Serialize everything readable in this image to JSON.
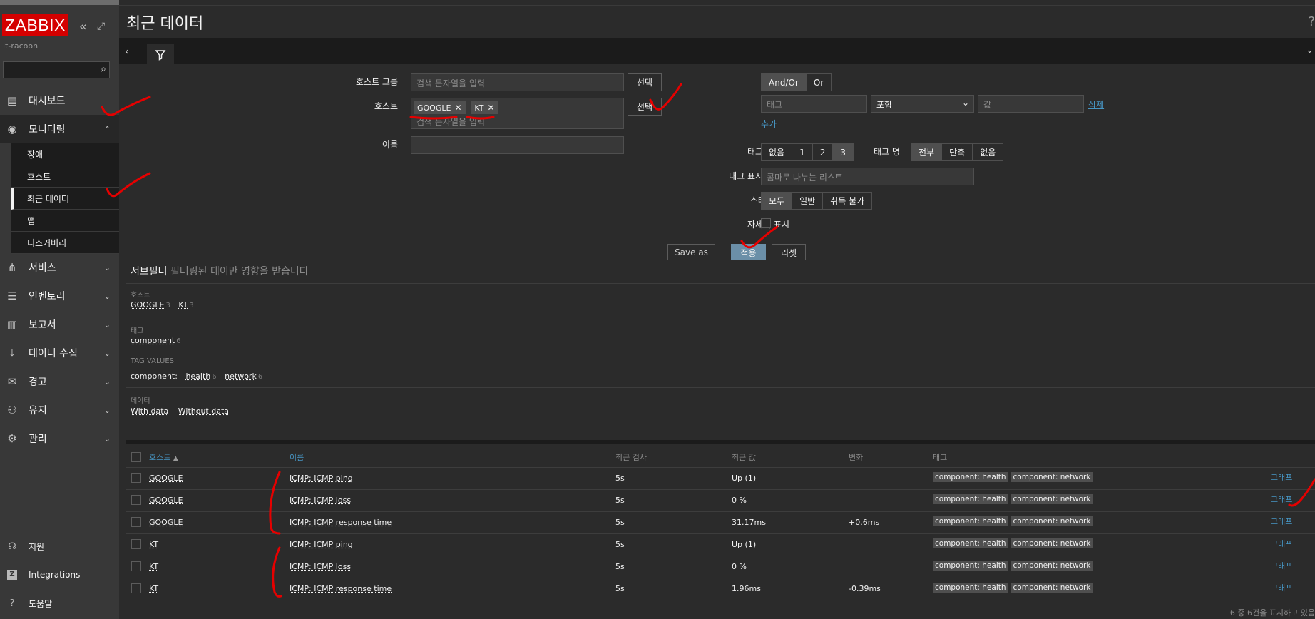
{
  "sidebar": {
    "logo": "ZABBIX",
    "server_name": "it-racoon",
    "menu": [
      {
        "label": "대시보드"
      },
      {
        "label": "모니터링"
      },
      {
        "label": "서비스"
      },
      {
        "label": "인벤토리"
      },
      {
        "label": "보고서"
      },
      {
        "label": "데이터 수집"
      },
      {
        "label": "경고"
      },
      {
        "label": "유저"
      },
      {
        "label": "관리"
      }
    ],
    "submenu": [
      "장애",
      "호스트",
      "최근 데이터",
      "맵",
      "디스커버리"
    ],
    "bottom": [
      "지원",
      "Integrations",
      "도움말"
    ]
  },
  "page": {
    "title": "최근 데이터",
    "help": "?"
  },
  "filter": {
    "host_group_label": "호스트 그룹",
    "host_group_placeholder": "검색 문자열을 입력",
    "select_label": "선택",
    "host_label": "호스트",
    "hosts": [
      "GOOGLE",
      "KT"
    ],
    "host_placeholder": "검색 문자열을 입력",
    "name_label": "이름",
    "tag_label": "태그",
    "tag_mode": [
      "And/Or",
      "Or"
    ],
    "tag_placeholder": "태그",
    "tag_operator": "포함",
    "value_placeholder": "값",
    "remove_label": "삭제",
    "add_label": "추가",
    "show_tags_label": "태그를 표시",
    "show_tags": [
      "없음",
      "1",
      "2",
      "3"
    ],
    "tag_name_label": "태그 명",
    "tag_name_options": [
      "전부",
      "단축",
      "없음"
    ],
    "tag_priority_label": "태그 표시 우선도",
    "tag_priority_placeholder": "콤마로 나누는 리스트",
    "state_label": "스테이터스",
    "state_options": [
      "모두",
      "일반",
      "취득 불가"
    ],
    "details_label": "자세히 표시",
    "save_as": "Save as",
    "apply": "적용",
    "reset": "리셋"
  },
  "subfilter": {
    "title": "서브필터",
    "hint": "필터링된 데이만 영향을 받습니다",
    "host_caption": "호스트",
    "hosts": [
      {
        "name": "GOOGLE",
        "count": "3"
      },
      {
        "name": "KT",
        "count": "3"
      }
    ],
    "tag_caption": "태그",
    "tags": [
      {
        "name": "component",
        "count": "6"
      }
    ],
    "tag_values_caption": "TAG VALUES",
    "tag_values_prefix": "component:",
    "tag_values": [
      {
        "name": "health",
        "count": "6"
      },
      {
        "name": "network",
        "count": "6"
      }
    ],
    "data_caption": "데이터",
    "data_options": [
      "With data",
      "Without data"
    ]
  },
  "table": {
    "headers": {
      "host": "호스트",
      "name": "이름",
      "last_check": "최근 검사",
      "last_value": "최근 값",
      "change": "변화",
      "tags": "태그"
    },
    "sort_indicator": "▲",
    "rows": [
      {
        "host": "GOOGLE",
        "name": "ICMP: ICMP ping",
        "last_check": "5s",
        "last_value": "Up (1)",
        "change": "",
        "tags": [
          "component: health",
          "component: network"
        ],
        "action": "그래프"
      },
      {
        "host": "GOOGLE",
        "name": "ICMP: ICMP loss",
        "last_check": "5s",
        "last_value": "0 %",
        "change": "",
        "tags": [
          "component: health",
          "component: network"
        ],
        "action": "그래프"
      },
      {
        "host": "GOOGLE",
        "name": "ICMP: ICMP response time",
        "last_check": "5s",
        "last_value": "31.17ms",
        "change": "+0.6ms",
        "tags": [
          "component: health",
          "component: network"
        ],
        "action": "그래프"
      },
      {
        "host": "KT",
        "name": "ICMP: ICMP ping",
        "last_check": "5s",
        "last_value": "Up (1)",
        "change": "",
        "tags": [
          "component: health",
          "component: network"
        ],
        "action": "그래프"
      },
      {
        "host": "KT",
        "name": "ICMP: ICMP loss",
        "last_check": "5s",
        "last_value": "0 %",
        "change": "",
        "tags": [
          "component: health",
          "component: network"
        ],
        "action": "그래프"
      },
      {
        "host": "KT",
        "name": "ICMP: ICMP response time",
        "last_check": "5s",
        "last_value": "1.96ms",
        "change": "-0.39ms",
        "tags": [
          "component: health",
          "component: network"
        ],
        "action": "그래프"
      }
    ],
    "footer": "6 중 6건을 표시하고 있음"
  },
  "colors": {
    "brand": "#d40000",
    "link": "#4796c4",
    "annotation": "#e60000"
  }
}
